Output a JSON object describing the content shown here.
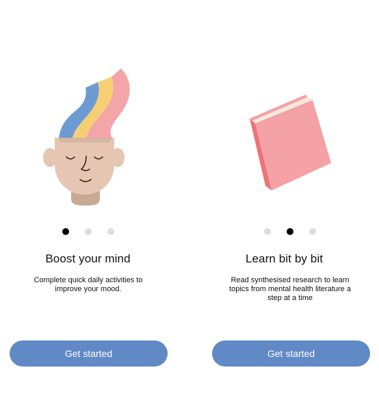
{
  "onboarding": {
    "slides": [
      {
        "title": "Boost your mind",
        "description": "Complete quick daily activities to improve your mood.",
        "button_label": "Get started",
        "active_dot": 0,
        "illustration": "head-with-rainbow-icon"
      },
      {
        "title": "Learn bit by bit",
        "description": "Read synthesised research to learn topics from mental health literature a step at a time",
        "button_label": "Get started",
        "active_dot": 1,
        "illustration": "book-icon"
      }
    ],
    "dot_count": 3
  },
  "colors": {
    "button": "#6089c6",
    "dot_active": "#000000",
    "dot_inactive": "#dddddd",
    "rainbow_blue": "#6b9bd2",
    "rainbow_yellow": "#f6cf75",
    "rainbow_pink": "#f4a5a8",
    "skin": "#e6c6b2",
    "neck": "#c6aa93",
    "book_cover": "#f4a2a5",
    "book_spine": "#ef7277",
    "book_pages": "#f7e8de"
  }
}
